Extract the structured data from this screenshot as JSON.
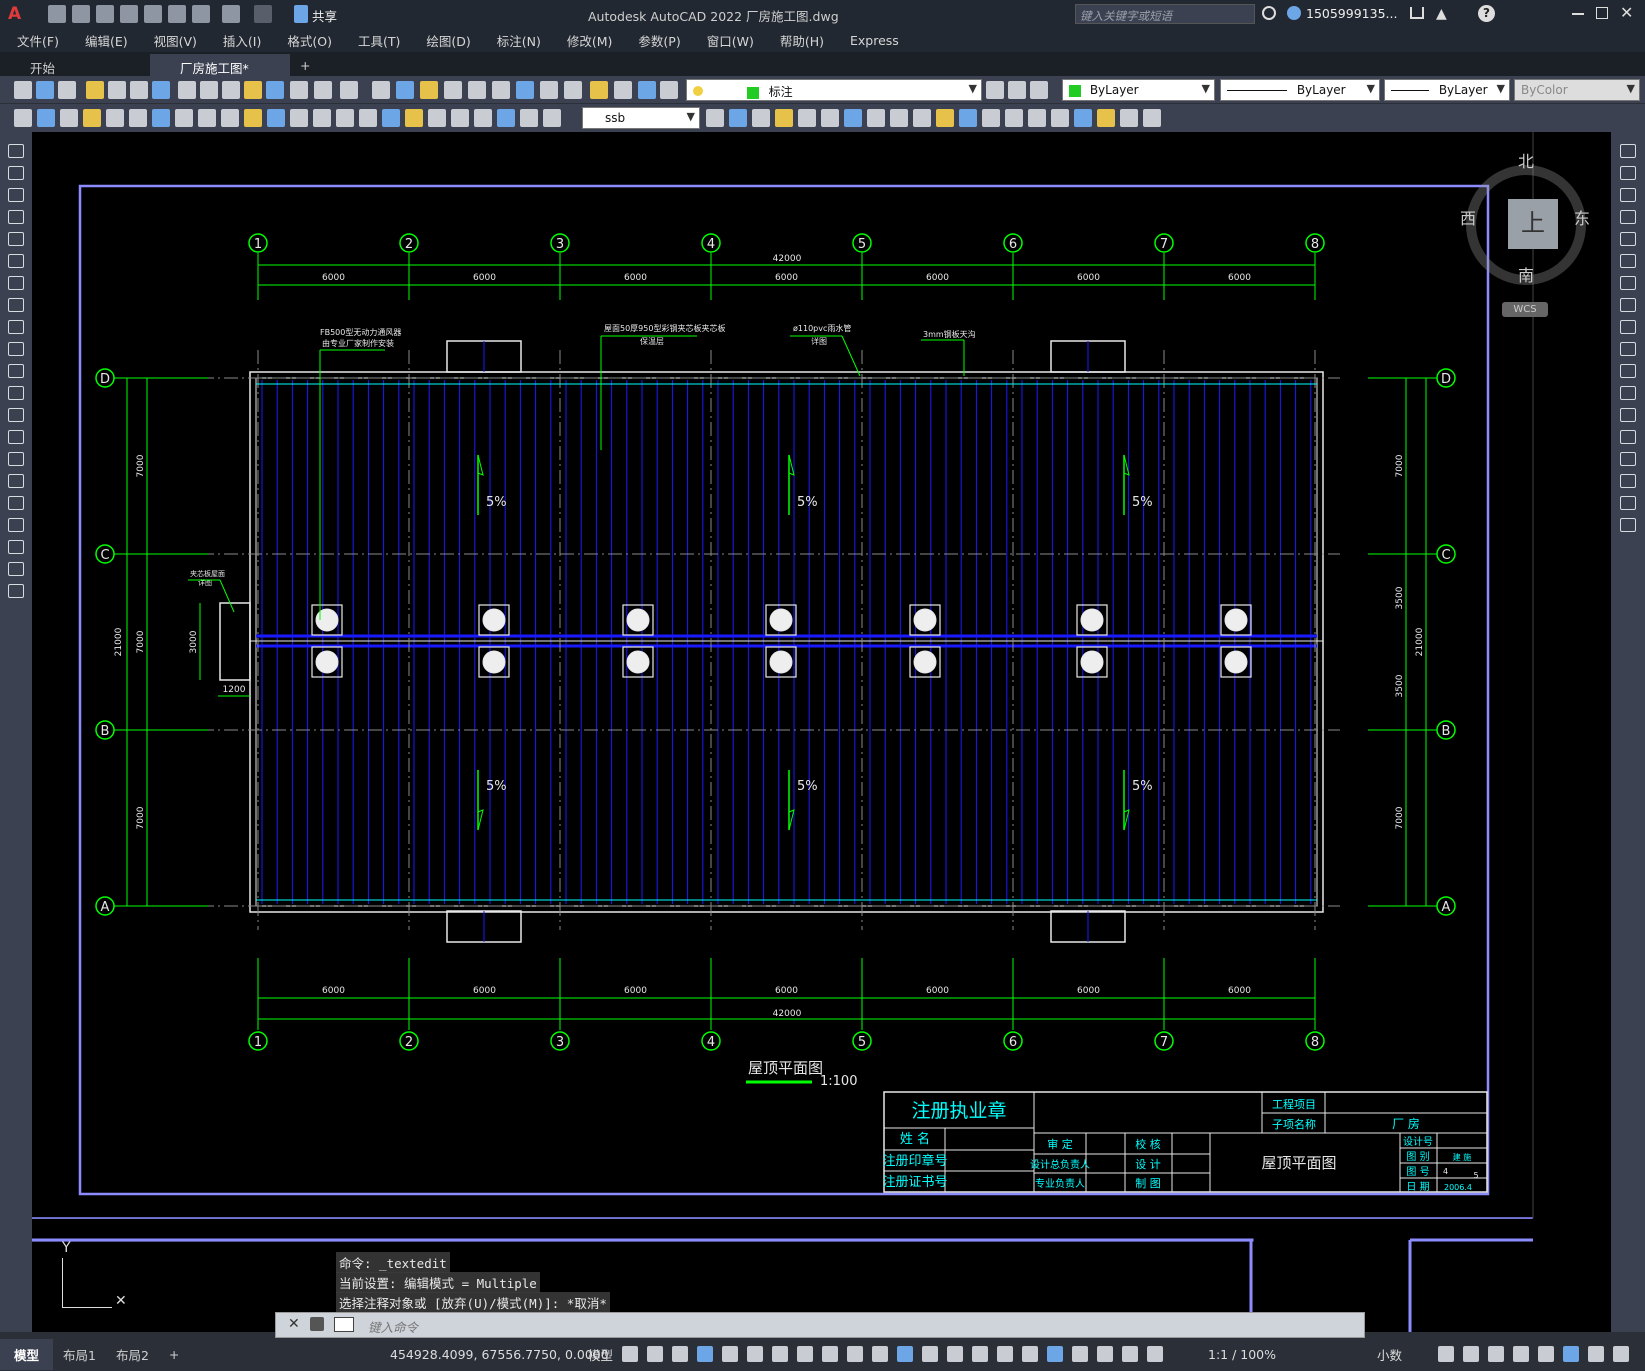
{
  "app": {
    "title": "Autodesk AutoCAD 2022    厂房施工图.dwg",
    "share_label": "共享",
    "search_placeholder": "键入关键字或短语",
    "user": "1505999135...",
    "logo": "A"
  },
  "menu": [
    "文件(F)",
    "编辑(E)",
    "视图(V)",
    "插入(I)",
    "格式(O)",
    "工具(T)",
    "绘图(D)",
    "标注(N)",
    "修改(M)",
    "参数(P)",
    "窗口(W)",
    "帮助(H)",
    "Express"
  ],
  "tabs": {
    "start": "开始",
    "file": "厂房施工图*",
    "add": "+"
  },
  "toolbar": {
    "layer": "标注",
    "color": "ByLayer",
    "linetype": "ByLayer",
    "lineweight": "ByLayer",
    "plotstyle": "ByColor",
    "dimstyle": "ssb"
  },
  "viewcube": {
    "north": "北",
    "south": "南",
    "east": "东",
    "west": "西",
    "top": "上",
    "wcs": "WCS"
  },
  "drawing": {
    "axes_x": [
      "1",
      "2",
      "3",
      "4",
      "5",
      "6",
      "7",
      "8"
    ],
    "axes_y": [
      "D",
      "C",
      "B",
      "A"
    ],
    "span": "6000",
    "total_x": "42000",
    "total_y": "21000",
    "bay": "7000",
    "half": "3500",
    "small1": "3000",
    "small2": "1200",
    "slope": "5%",
    "note1a": "FB500型无动力通风器",
    "note1b": "由专业厂家制作安装",
    "note2a": "屋面50厚950型彩钢夹芯板夹芯板",
    "note2b": "保温层",
    "note3a": "ø110pvc雨水管",
    "note3b": "详图",
    "note4": "3mm钢板天沟",
    "note5a": "夹芯板屋面",
    "note5b": "详图",
    "title": "屋顶平面图",
    "scale": "1:100"
  },
  "titleblock": {
    "stamp": "注册执业章",
    "name": "姓  名",
    "seal": "注册印章号",
    "cert": "注册证书号",
    "approve": "审  定",
    "head": "设计总负责人",
    "charge": "专业负责人",
    "check": "校  核",
    "design": "设  计",
    "draw": "制  图",
    "project": "工程项目",
    "sub": "子项名称",
    "sub_val": "厂        房",
    "drawing_name": "屋顶平面图",
    "design_no": "设计号",
    "category": "图  别",
    "category_val": "建  施",
    "sheet": "图  号",
    "sheet_val": "4",
    "sheet_total": "5",
    "date": "日  期",
    "date_val": "2006.4"
  },
  "command": {
    "h1": "命令: _textedit",
    "h2": "当前设置: 编辑模式 = Multiple",
    "h3": "选择注释对象或 [放弃(U)/模式(M)]: *取消*",
    "placeholder": "键入命令"
  },
  "status": {
    "model": "模型",
    "layout1": "布局1",
    "layout2": "布局2",
    "add": "+",
    "coords": "454928.4099, 67556.7750, 0.0000",
    "space": "模型",
    "scale": "1:1 / 100%",
    "units": "小数"
  },
  "ucs": {
    "y": "Y"
  }
}
